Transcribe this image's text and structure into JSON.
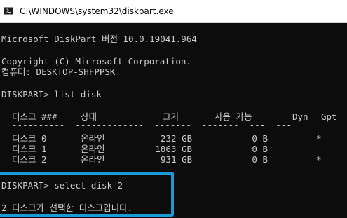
{
  "window": {
    "title": "C:\\WINDOWS\\system32\\diskpart.exe"
  },
  "console": {
    "version_line": "Microsoft DiskPart 버전 10.0.19041.964",
    "copyright_line": "Copyright (C) Microsoft Corporation.",
    "computer_line": "컴퓨터: DESKTOP-SHFPPSK",
    "prompt1": "DISKPART> list disk",
    "table": {
      "headers": [
        "디스크 ###",
        "상태",
        "크기",
        "사용 가능",
        "Dyn",
        "Gpt"
      ],
      "separator": "----------  -------------  -------  -------  ---  ---",
      "rows": [
        [
          "디스크 0",
          "온라인",
          "232 GB",
          "0 B",
          "",
          "*"
        ],
        [
          "디스크 1",
          "온라인",
          "1863 GB",
          "0 B",
          "",
          ""
        ],
        [
          "디스크 2",
          "온라인",
          "931 GB",
          "0 B",
          "",
          "*"
        ]
      ]
    },
    "prompt2": "DISKPART> select disk 2",
    "result": "2 디스크가 선택한 디스크입니다."
  },
  "colors": {
    "background": "#0c0c0c",
    "text": "#cccccc",
    "highlight": "#1a9bd7"
  }
}
